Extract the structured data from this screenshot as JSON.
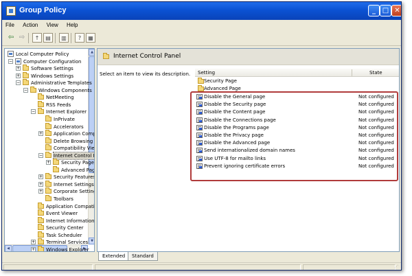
{
  "window": {
    "title": "Group Policy"
  },
  "menu": [
    "File",
    "Action",
    "View",
    "Help"
  ],
  "tree": [
    {
      "label": "Local Computer Policy",
      "depth": 0,
      "expander": "",
      "icon": "doc"
    },
    {
      "label": "Computer Configuration",
      "depth": 1,
      "expander": "−",
      "icon": "doc"
    },
    {
      "label": "Software Settings",
      "depth": 2,
      "expander": "+",
      "icon": "folder"
    },
    {
      "label": "Windows Settings",
      "depth": 2,
      "expander": "+",
      "icon": "folder"
    },
    {
      "label": "Administrative Templates",
      "depth": 2,
      "expander": "−",
      "icon": "folder"
    },
    {
      "label": "Windows Components",
      "depth": 3,
      "expander": "−",
      "icon": "folder"
    },
    {
      "label": "NetMeeting",
      "depth": 4,
      "expander": "",
      "icon": "folder"
    },
    {
      "label": "RSS Feeds",
      "depth": 4,
      "expander": "",
      "icon": "folder"
    },
    {
      "label": "Internet Explorer",
      "depth": 4,
      "expander": "−",
      "icon": "folder"
    },
    {
      "label": "InPrivate",
      "depth": 5,
      "expander": "",
      "icon": "folder"
    },
    {
      "label": "Accelerators",
      "depth": 5,
      "expander": "",
      "icon": "folder"
    },
    {
      "label": "Application Compatibility",
      "depth": 5,
      "expander": "+",
      "icon": "folder"
    },
    {
      "label": "Delete Browsing History",
      "depth": 5,
      "expander": "",
      "icon": "folder"
    },
    {
      "label": "Compatibility View",
      "depth": 5,
      "expander": "",
      "icon": "folder"
    },
    {
      "label": "Internet Control Panel",
      "depth": 5,
      "expander": "−",
      "icon": "folder",
      "selected": true
    },
    {
      "label": "Security Page",
      "depth": 6,
      "expander": "+",
      "icon": "folder"
    },
    {
      "label": "Advanced Page",
      "depth": 6,
      "expander": "",
      "icon": "folder"
    },
    {
      "label": "Security Features",
      "depth": 5,
      "expander": "+",
      "icon": "folder"
    },
    {
      "label": "Internet Settings",
      "depth": 5,
      "expander": "+",
      "icon": "folder"
    },
    {
      "label": "Corporate Settings",
      "depth": 5,
      "expander": "+",
      "icon": "folder"
    },
    {
      "label": "Toolbars",
      "depth": 5,
      "expander": "",
      "icon": "folder"
    },
    {
      "label": "Application Compatibility",
      "depth": 4,
      "expander": "",
      "icon": "folder"
    },
    {
      "label": "Event Viewer",
      "depth": 4,
      "expander": "",
      "icon": "folder"
    },
    {
      "label": "Internet Information Services",
      "depth": 4,
      "expander": "",
      "icon": "folder"
    },
    {
      "label": "Security Center",
      "depth": 4,
      "expander": "",
      "icon": "folder"
    },
    {
      "label": "Task Scheduler",
      "depth": 4,
      "expander": "",
      "icon": "folder"
    },
    {
      "label": "Terminal Services",
      "depth": 4,
      "expander": "+",
      "icon": "folder"
    },
    {
      "label": "Windows Explorer",
      "depth": 4,
      "expander": "+",
      "icon": "folder"
    }
  ],
  "panel": {
    "title": "Internet Control Panel",
    "description": "Select an item to view its description.",
    "col_setting": "Setting",
    "col_state": "State",
    "folders": [
      "Security Page",
      "Advanced Page"
    ],
    "settings": [
      {
        "name": "Disable the General page",
        "state": "Not configured"
      },
      {
        "name": "Disable the Security page",
        "state": "Not configured"
      },
      {
        "name": "Disable the Content page",
        "state": "Not configured"
      },
      {
        "name": "Disable the Connections page",
        "state": "Not configured"
      },
      {
        "name": "Disable the Programs page",
        "state": "Not configured"
      },
      {
        "name": "Disable the Privacy page",
        "state": "Not configured"
      },
      {
        "name": "Disable the Advanced page",
        "state": "Not configured"
      },
      {
        "name": "Send internationalized domain names",
        "state": "Not configured"
      },
      {
        "name": "Use UTF-8 for mailto links",
        "state": "Not configured"
      },
      {
        "name": "Prevent ignoring certificate errors",
        "state": "Not configured"
      }
    ]
  },
  "tabs": [
    "Extended",
    "Standard"
  ],
  "colors": {
    "title_bar": "#0b52d4",
    "highlight_box": "#b03a3a"
  }
}
